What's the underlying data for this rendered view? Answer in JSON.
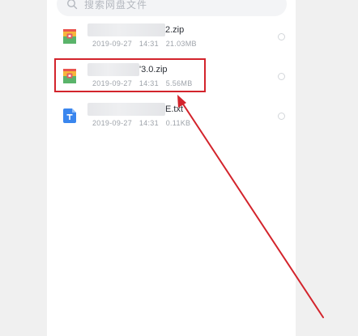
{
  "search": {
    "placeholder": "搜索网盘文件",
    "icon": "search-icon"
  },
  "files": [
    {
      "name_suffix": "2.zip",
      "date": "2019-09-27",
      "time": "14:31",
      "size": "21.03MB",
      "type": "zip",
      "icon": "zip-file-icon"
    },
    {
      "name_suffix": "'3.0.zip",
      "date": "2019-09-27",
      "time": "14:31",
      "size": "5.56MB",
      "type": "zip",
      "icon": "zip-file-icon"
    },
    {
      "name_suffix": "E.txt",
      "date": "2019-09-27",
      "time": "14:31",
      "size": "0.11KB",
      "type": "txt",
      "icon": "text-file-icon"
    }
  ],
  "annotation": {
    "highlight_color": "#d3242c",
    "arrow_color": "#d3242c"
  }
}
